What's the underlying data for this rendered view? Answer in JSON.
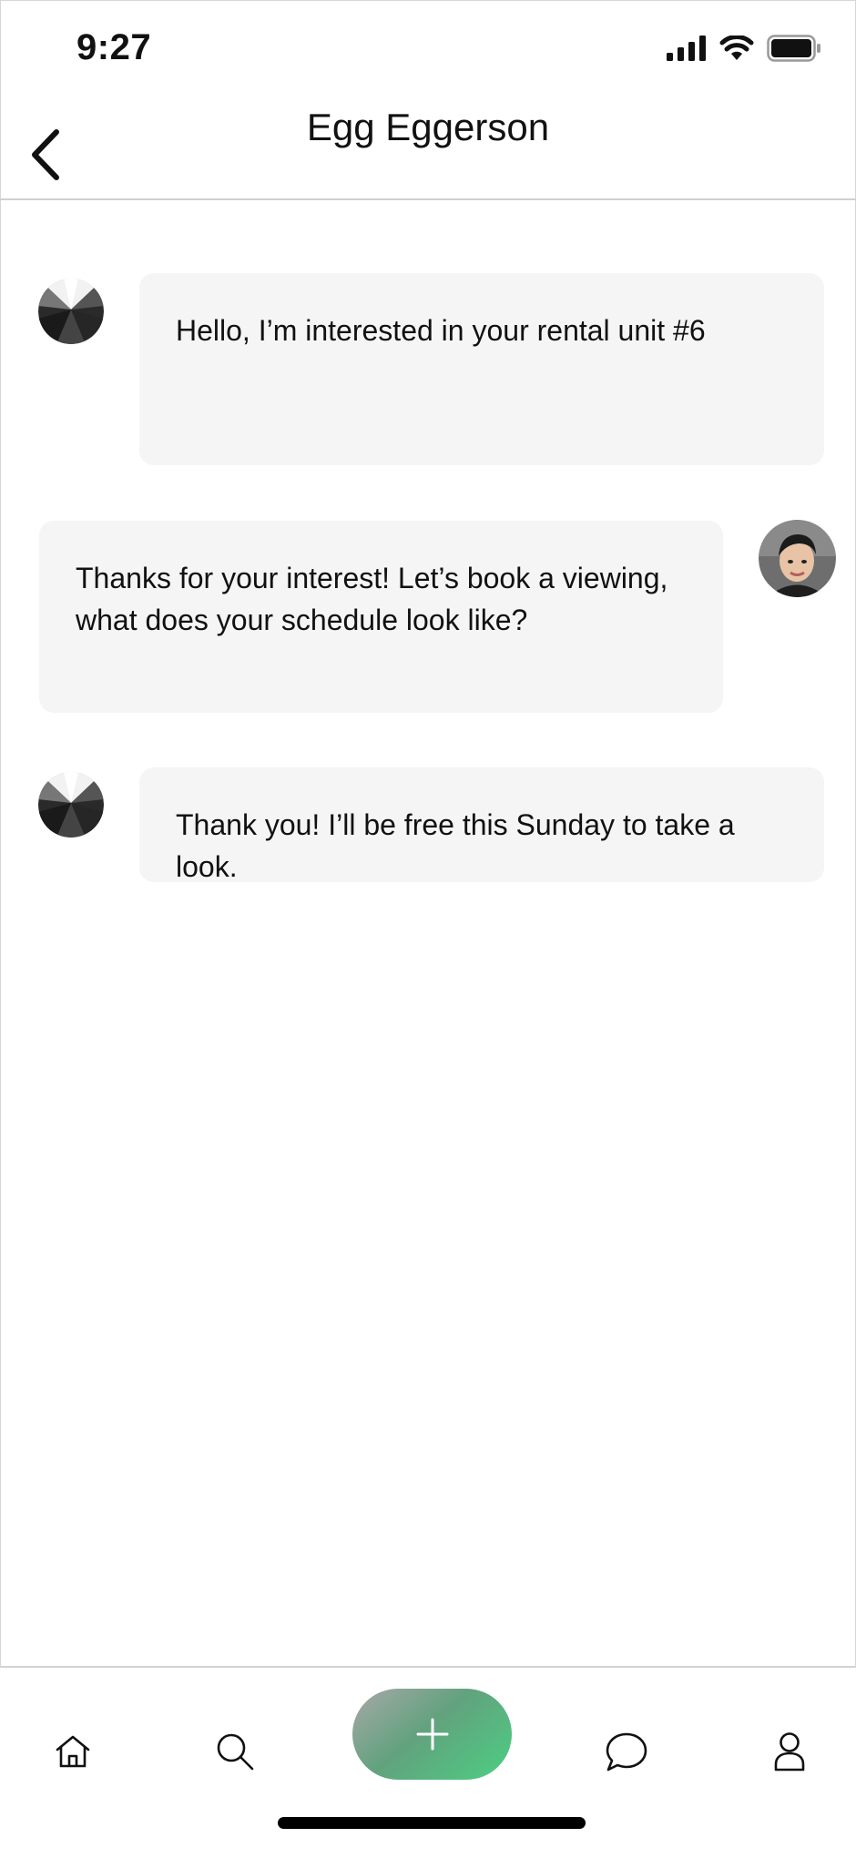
{
  "status_bar": {
    "time": "9:27",
    "icons": [
      "signal-icon",
      "wifi-icon",
      "battery-icon"
    ]
  },
  "header": {
    "title": "Egg Eggerson",
    "back_icon": "chevron-left-icon"
  },
  "messages": [
    {
      "sender": "other",
      "text": "Hello, I’m interested in your rental unit #6"
    },
    {
      "sender": "me",
      "text": "Thanks for your interest! Let’s book a viewing, what does your schedule look like?"
    },
    {
      "sender": "other",
      "text": "Thank you! I’ll be free this Sunday to take a look."
    }
  ],
  "bottom_nav": {
    "items": [
      "home-icon",
      "search-icon",
      "add-icon",
      "chat-icon",
      "profile-icon"
    ]
  },
  "colors": {
    "bubble": "#f5f5f5",
    "accent_green": "#4ccf82",
    "accent_gray": "#a8a8a8"
  }
}
